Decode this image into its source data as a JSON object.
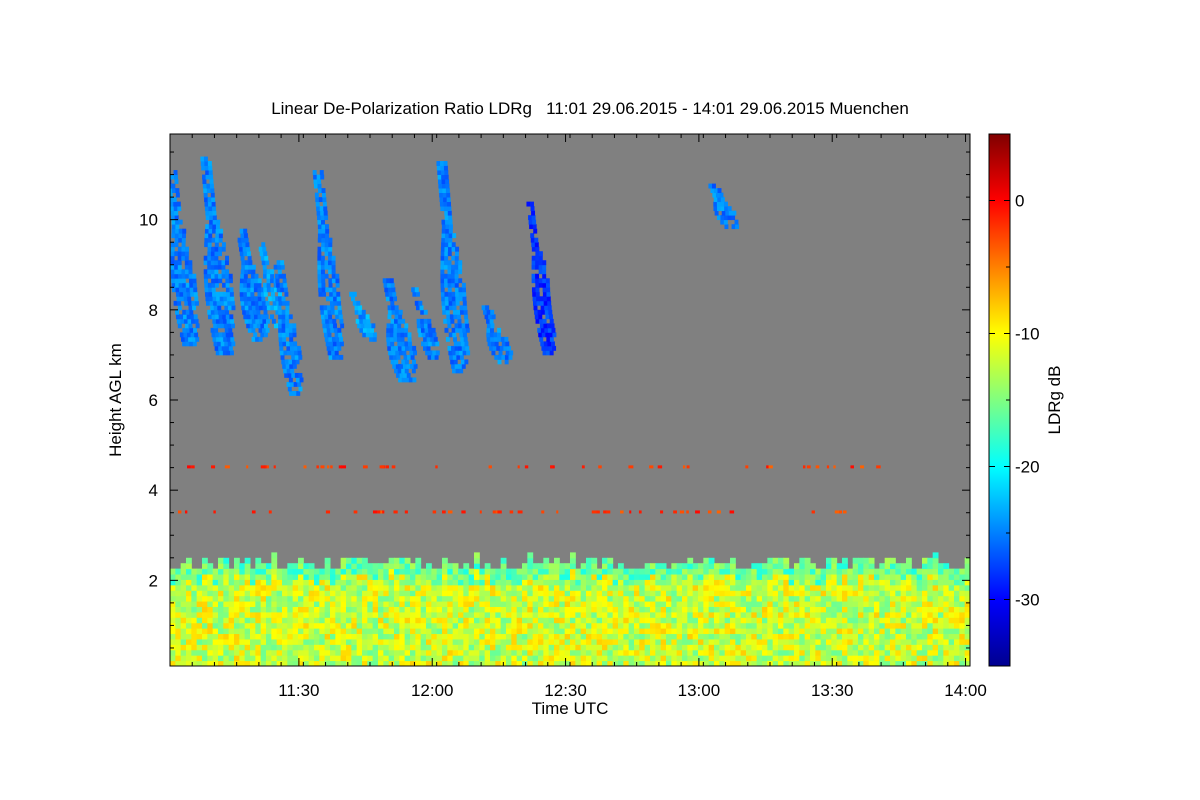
{
  "chart_data": {
    "type": "heatmap",
    "title": "Linear De-Polarization Ratio LDRg   11:01 29.06.2015 - 14:01 29.06.2015 Muenchen",
    "xlabel": "Time UTC",
    "ylabel": "Height AGL km",
    "colorbar_label": "LDRg dB",
    "x_range_min": [
      661,
      841
    ],
    "x_ticks": [
      690,
      720,
      750,
      780,
      810,
      840
    ],
    "x_tick_labels": [
      "11:30",
      "12:00",
      "12:30",
      "13:00",
      "13:30",
      "14:00"
    ],
    "y_range_km": [
      0.1,
      11.9
    ],
    "y_ticks": [
      2,
      4,
      6,
      8,
      10
    ],
    "y_tick_labels": [
      "2",
      "4",
      "6",
      "8",
      "10"
    ],
    "colorbar_range_db": [
      -35,
      5
    ],
    "colorbar_ticks": [
      0,
      -10,
      -20,
      -30
    ],
    "colorbar_tick_labels": [
      "0",
      "-10",
      "-20",
      "-30"
    ],
    "colormap": "jet",
    "background_color": "#808080",
    "boundary_layer": {
      "top_km": 2.3,
      "typical_ldr_db": -12
    },
    "cirrus_clouds": [
      {
        "t_min": 661.2,
        "top_km": 11.0,
        "bottom_km": 7.2,
        "ldr_db": -25
      },
      {
        "t_min": 669.0,
        "top_km": 11.3,
        "bottom_km": 7.0,
        "ldr_db": -25
      },
      {
        "t_min": 677.0,
        "top_km": 9.7,
        "bottom_km": 7.3,
        "ldr_db": -25
      },
      {
        "t_min": 681.5,
        "top_km": 9.4,
        "bottom_km": 7.6,
        "ldr_db": -24
      },
      {
        "t_min": 685.0,
        "top_km": 9.0,
        "bottom_km": 6.1,
        "ldr_db": -25
      },
      {
        "t_min": 694.0,
        "top_km": 11.0,
        "bottom_km": 6.9,
        "ldr_db": -25
      },
      {
        "t_min": 702.0,
        "top_km": 8.3,
        "bottom_km": 7.3,
        "ldr_db": -24
      },
      {
        "t_min": 710.0,
        "top_km": 8.6,
        "bottom_km": 6.4,
        "ldr_db": -25
      },
      {
        "t_min": 716.0,
        "top_km": 8.4,
        "bottom_km": 6.9,
        "ldr_db": -25
      },
      {
        "t_min": 722.0,
        "top_km": 11.2,
        "bottom_km": 6.6,
        "ldr_db": -25
      },
      {
        "t_min": 732.0,
        "top_km": 8.0,
        "bottom_km": 6.8,
        "ldr_db": -25
      },
      {
        "t_min": 742.0,
        "top_km": 10.3,
        "bottom_km": 7.0,
        "ldr_db": -28
      },
      {
        "t_min": 783.0,
        "top_km": 10.7,
        "bottom_km": 9.8,
        "ldr_db": -25
      }
    ],
    "grid": false
  }
}
